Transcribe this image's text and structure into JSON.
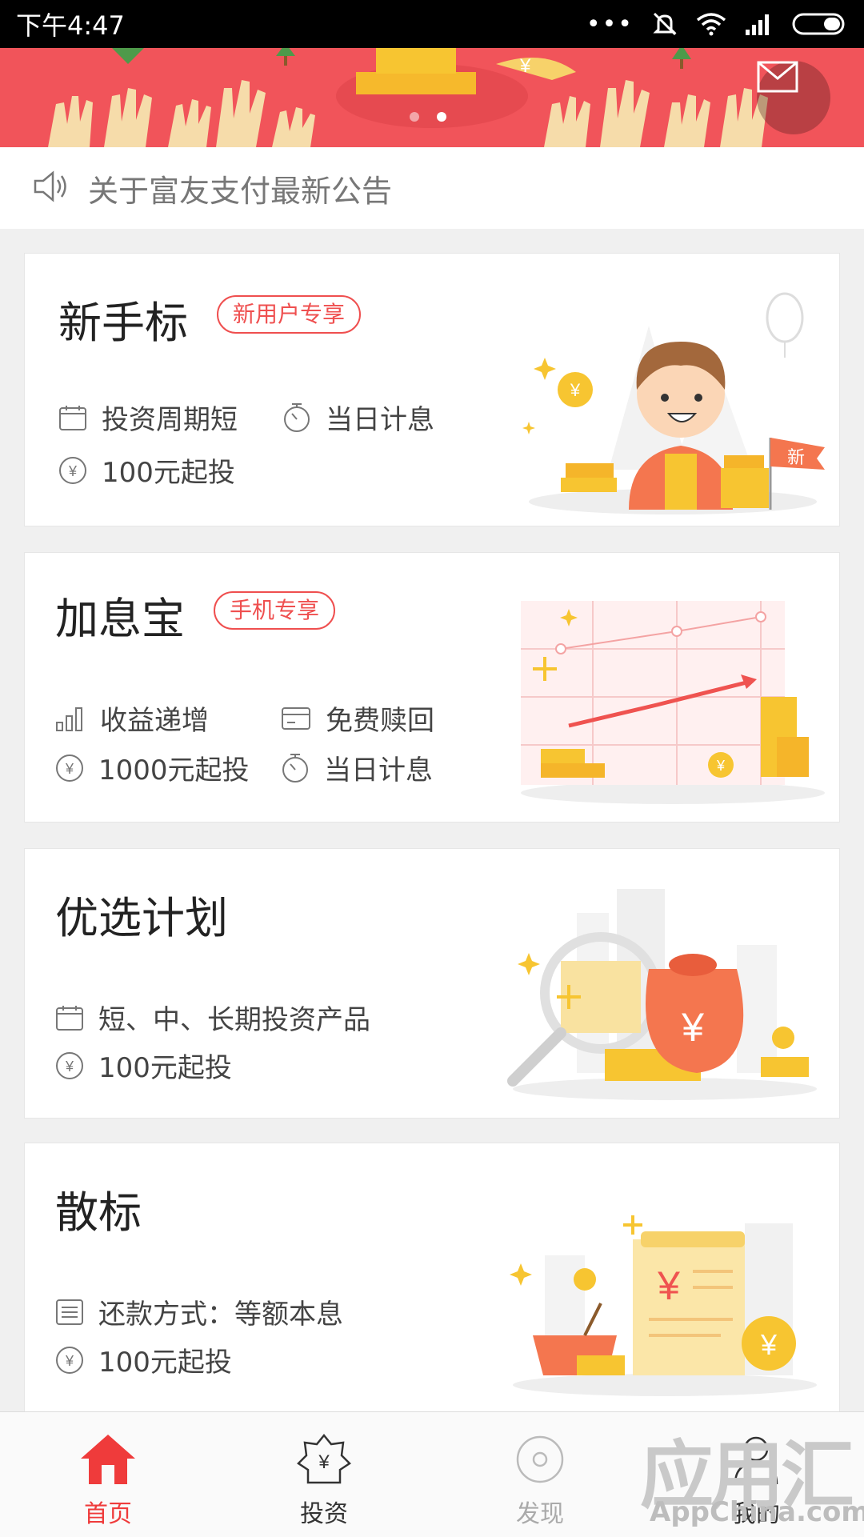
{
  "status_bar": {
    "time": "下午4:47",
    "dots": "•••"
  },
  "banner": {
    "mail_icon": "mail-icon",
    "page_count": 2,
    "active_page": 2
  },
  "notice": {
    "icon": "speaker-icon",
    "text": "关于富友支付最新公告"
  },
  "cards": [
    {
      "title": "新手标",
      "tag": "新用户专享",
      "features": [
        "投资周期短",
        "当日计息",
        "100元起投"
      ],
      "illustration_text": "新"
    },
    {
      "title": "加息宝",
      "tag": "手机专享",
      "features": [
        "收益递增",
        "免费赎回",
        "1000元起投",
        "当日计息"
      ]
    },
    {
      "title": "优选计划",
      "features": [
        "短、中、长期投资产品",
        "100元起投"
      ]
    },
    {
      "title": "散标",
      "features": [
        "还款方式：等额本息",
        "100元起投"
      ]
    }
  ],
  "tabbar": {
    "items": [
      {
        "label": "首页",
        "icon": "home-icon",
        "active": true
      },
      {
        "label": "投资",
        "icon": "invest-icon",
        "active": false
      },
      {
        "label": "发现",
        "icon": "discover-icon",
        "active": false
      },
      {
        "label": "我的",
        "icon": "profile-icon",
        "active": false
      }
    ]
  },
  "watermark": {
    "big": "应用汇",
    "small": "AppChina.com"
  },
  "colors": {
    "accent": "#ef3b3b",
    "banner": "#f1545a",
    "gold": "#f7c531"
  }
}
